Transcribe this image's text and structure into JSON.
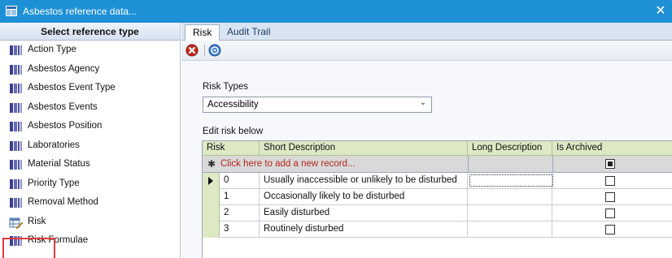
{
  "window": {
    "title": "Asbestos reference data...",
    "close_glyph": "✕",
    "title_bg": "#1e90d6"
  },
  "sidebar": {
    "header": "Select reference type",
    "items": [
      {
        "label": "Action Type",
        "icon": "database-icon"
      },
      {
        "label": "Asbestos Agency",
        "icon": "database-icon"
      },
      {
        "label": "Asbestos Event Type",
        "icon": "database-icon"
      },
      {
        "label": "Asbestos Events",
        "icon": "database-icon"
      },
      {
        "label": "Asbestos Position",
        "icon": "database-icon"
      },
      {
        "label": "Laboratories",
        "icon": "database-icon"
      },
      {
        "label": "Material Status",
        "icon": "database-icon"
      },
      {
        "label": "Priority Type",
        "icon": "database-icon"
      },
      {
        "label": "Removal Method",
        "icon": "database-icon"
      },
      {
        "label": "Risk",
        "icon": "table-edit-icon",
        "selected": true
      },
      {
        "label": "Risk Formulae",
        "icon": "database-icon"
      }
    ],
    "highlight_color": "#e23b3b"
  },
  "tabs": [
    {
      "label": "Risk",
      "active": true
    },
    {
      "label": "Audit Trail",
      "active": false
    }
  ],
  "toolbar": {
    "buttons": [
      "delete-icon",
      "help-icon"
    ]
  },
  "form": {
    "risk_types_label": "Risk Types",
    "risk_types_value": "Accessibility",
    "edit_label": "Edit risk below"
  },
  "grid": {
    "columns": [
      "Risk",
      "Short Description",
      "Long Description",
      "Is Archived"
    ],
    "new_record_text": "Click here to add a new record...",
    "new_record_star": "✱",
    "rows": [
      {
        "risk": "0",
        "short": "Usually inaccessible or unlikely to be disturbed",
        "long": "",
        "archived": false,
        "current": true
      },
      {
        "risk": "1",
        "short": "Occasionally likely to be disturbed",
        "long": "",
        "archived": false
      },
      {
        "risk": "2",
        "short": "Easily disturbed",
        "long": "",
        "archived": false
      },
      {
        "risk": "3",
        "short": "Routinely disturbed",
        "long": "",
        "archived": false
      }
    ],
    "header_bg": "#dde8c4"
  }
}
